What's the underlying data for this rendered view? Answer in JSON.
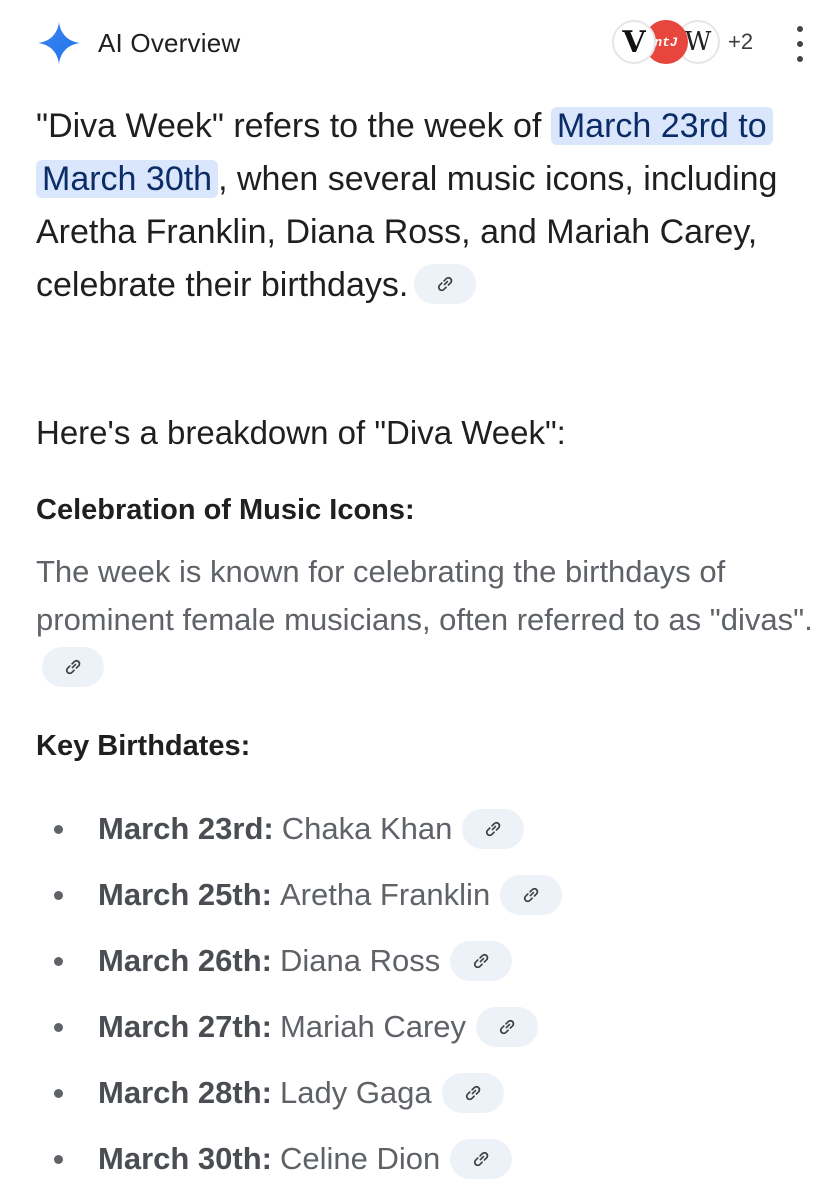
{
  "header": {
    "title": "AI Overview",
    "sources": [
      {
        "label": "V",
        "icon": "serif-v-logo"
      },
      {
        "label": "ntJ",
        "icon": "red-badge-logo",
        "color": "#e8453c"
      },
      {
        "label": "W",
        "icon": "wikipedia-logo"
      }
    ],
    "sources_more": "+2",
    "menu_icon": "more-vert-icon",
    "sparkle_colors": [
      "#4285f4",
      "#1a73e8"
    ]
  },
  "intro": {
    "before": "\"Diva Week\" refers to the week of ",
    "highlight": "March 23rd to March 30th",
    "after": ", when several music icons, including Aretha Franklin, Diana Ross, and Mariah Carey, celebrate their birthdays.",
    "highlight_color": "#d9e6fb"
  },
  "breakdown_heading": "Here's a breakdown of \"Diva Week\":",
  "celebration": {
    "heading": "Celebration of Music Icons:",
    "body": "The week is known for celebrating the birthdays of prominent female musicians, often referred to as \"divas\"."
  },
  "birthdates": {
    "heading": "Key Birthdates:",
    "items": [
      {
        "date": "March 23rd:",
        "name": "Chaka Khan"
      },
      {
        "date": "March 25th:",
        "name": "Aretha Franklin"
      },
      {
        "date": "March 26th:",
        "name": "Diana Ross"
      },
      {
        "date": "March 27th:",
        "name": "Mariah Carey"
      },
      {
        "date": "March 28th:",
        "name": "Lady Gaga"
      },
      {
        "date": "March 30th:",
        "name": "Celine Dion"
      }
    ]
  },
  "link_chip_icon": "link-icon"
}
